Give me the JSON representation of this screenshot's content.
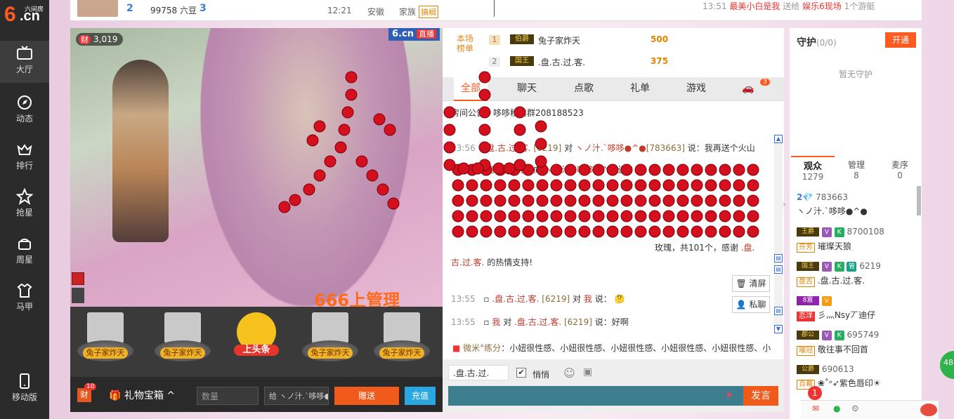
{
  "brand": {
    "logo_text": "6.cn",
    "logo_small": "六间房"
  },
  "rail": {
    "items": [
      {
        "label": "大厅",
        "icon": "tv-icon"
      },
      {
        "label": "动态",
        "icon": "compass-icon"
      },
      {
        "label": "排行",
        "icon": "crown-icon"
      },
      {
        "label": "抢星",
        "icon": "star-icon"
      },
      {
        "label": "周星",
        "icon": "gift-basket-icon"
      },
      {
        "label": "马甲",
        "icon": "shirt-icon"
      }
    ],
    "mobile": "移动版"
  },
  "topbar": {
    "level1": "2",
    "beans": "99758 六豆",
    "level2": "3",
    "time": "12:21",
    "location": "安徽",
    "family_label": "家族",
    "family_tag": "搞榈",
    "ticker_time": "13:51",
    "ticker_text1": "最美小白是我",
    "ticker_text2": "送给",
    "ticker_text3": "娱乐6现场",
    "ticker_text4": "1个游艇"
  },
  "video": {
    "wealth_label": "财",
    "wealth_count": "3,019",
    "live_brand": "6.cn",
    "live_label": "直播",
    "overlay_banner": "666上管理"
  },
  "headlines": {
    "items": [
      "兔子家炸天",
      "兔子家炸天",
      "上头条",
      "兔子家炸天",
      "兔子家炸天"
    ]
  },
  "giftbar": {
    "wealth_label": "财",
    "wealth_badge": "10",
    "gift_box": "礼物宝箱",
    "qty_placeholder": "数量",
    "to_text": "给 ヽノ汁.`哆哆●^●",
    "send": "赠送",
    "recharge": "充值"
  },
  "rank": {
    "label1": "本场",
    "label2": "榜单",
    "rows": [
      {
        "no": "1",
        "badge": "伯爵",
        "name": "兔子家炸天",
        "score": "500"
      },
      {
        "no": "2",
        "badge": "国王",
        "name": ".盘.古.过.客.",
        "score": "375"
      }
    ]
  },
  "tabs": [
    "全部",
    "聊天",
    "点歌",
    "礼单",
    "游戏"
  ],
  "car_badge": "3",
  "chat": {
    "notice": "房间公告：哆哆粉丝群208188523",
    "m1": {
      "time": "13:56",
      "user": ".盘.古.过.客.",
      "id": "[6219]",
      "mid": "对",
      "target": "ヽノ汁.`哆哆●^●",
      "tid": "[783663]",
      "text": "说：我再送个火山"
    },
    "m2": {
      "time": "13:57",
      "user": ".盘.古.过.客.",
      "mid": "向",
      "target": "ヽノ汁.`哆哆●^●",
      "text": "送"
    },
    "m3": {
      "text1": "玫瑰，共101个，感谢",
      "user": ".盘.",
      "text2": "古.过.客.",
      "text3": "的热情支持!"
    },
    "m4": {
      "time": "13:55",
      "user": ".盘.古.过.客.",
      "id": "[6219]",
      "mid": "对",
      "me": "我",
      "text": "说："
    },
    "m5": {
      "time": "13:55",
      "me": "我",
      "mid": "对",
      "user": ".盘.古.过.客.",
      "id": "[6219]",
      "text": "说：好啊"
    },
    "bottom_ticker_name": "微米°练分",
    "bottom_ticker_text": "：小妞很性感、小妞很性感、小妞很性感、小妞很性感、小妞很性感、小"
  },
  "chat_tools": {
    "clear": "清屏",
    "private": "私聊"
  },
  "input": {
    "self_name": ".盘.古.过.",
    "quiet": "悄悄",
    "send": "发言"
  },
  "guard": {
    "title": "守护",
    "count": "(0/0)",
    "open": "开通",
    "empty": "暂无守护"
  },
  "audience_tabs": [
    {
      "label": "观众",
      "num": "1279"
    },
    {
      "label": "管理",
      "num": "8"
    },
    {
      "label": "麦序",
      "num": "0"
    }
  ],
  "audience": [
    {
      "badge": "",
      "level": "2",
      "id": "783663",
      "name": "ヽノ汁.`哆哆●^●"
    },
    {
      "badge": "王爵",
      "id": "8700108",
      "fam": "芬芳",
      "name": "璀璨天狼"
    },
    {
      "badge": "国王",
      "id": "6219",
      "fam": "盘古",
      "name": ".盘.古.过.客."
    },
    {
      "badge": "8富",
      "id": "",
      "fam": "恋洋",
      "name": "彡灬Nsy丆迪仔"
    },
    {
      "badge": "郡公",
      "id": "695749",
      "fam": "璀冠",
      "name": "敬往事不回首"
    },
    {
      "badge": "公爵",
      "id": "690613",
      "fam": "百幕",
      "name": "❀˚ᵒ➶紫色唇印☀"
    }
  ],
  "notif_count": "1",
  "side_circle": "48"
}
